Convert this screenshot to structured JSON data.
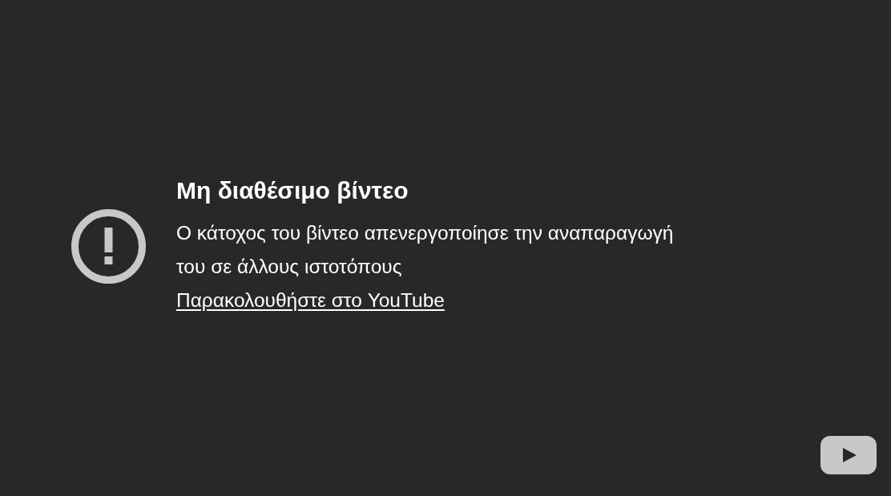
{
  "error": {
    "title": "Μη διαθέσιμο βίντεο",
    "message": "Ο κάτοχος του βίντεο απενεργοποίησε την αναπαραγωγή του σε άλλους ιστοτόπους",
    "link": "Παρακολουθήστε στο YouTube"
  }
}
